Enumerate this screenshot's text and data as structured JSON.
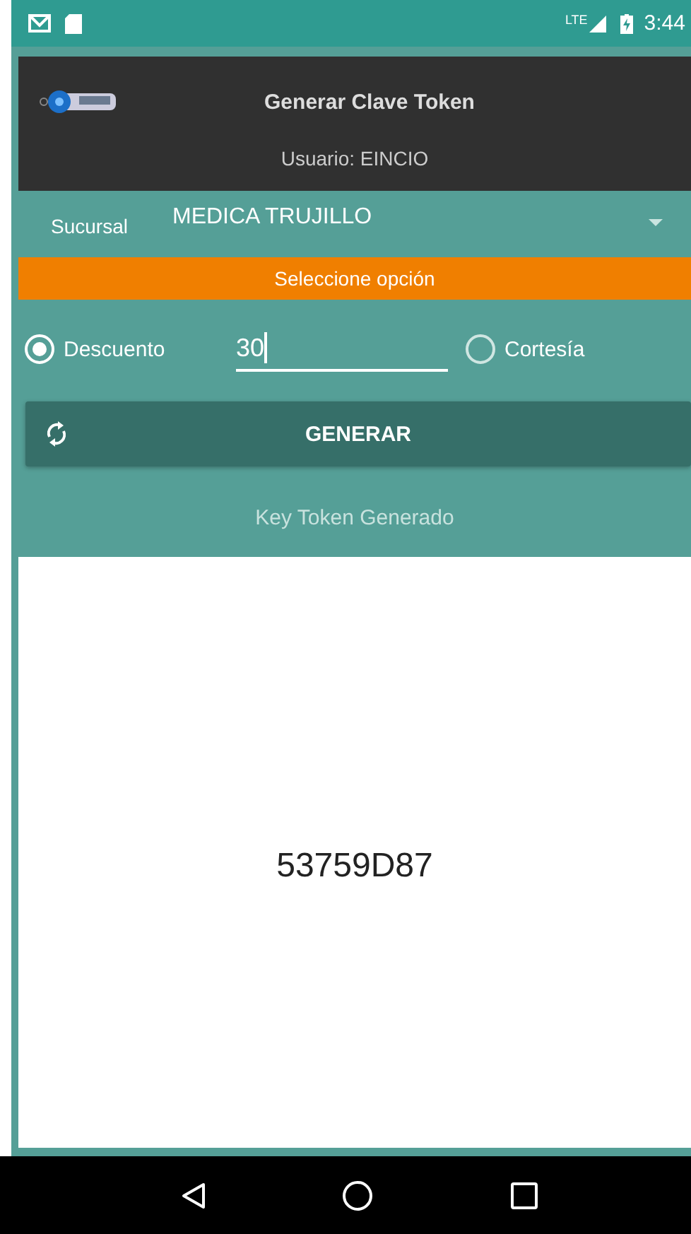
{
  "status_bar": {
    "time": "3:44",
    "network": "LTE"
  },
  "header": {
    "title": "Generar Clave Token",
    "user": "Usuario: EINCIO"
  },
  "branch": {
    "label": "Sucursal",
    "value": "MEDICA TRUJILLO"
  },
  "banner": "Seleccione opción",
  "options": [
    {
      "label": "Descuento",
      "selected": true
    },
    {
      "label": "Cortesía",
      "selected": false
    }
  ],
  "amount_field": {
    "value": "30",
    "focused": true
  },
  "generate_button": "GENERAR",
  "result_label": "Key Token Generado",
  "token": "53759D87"
}
